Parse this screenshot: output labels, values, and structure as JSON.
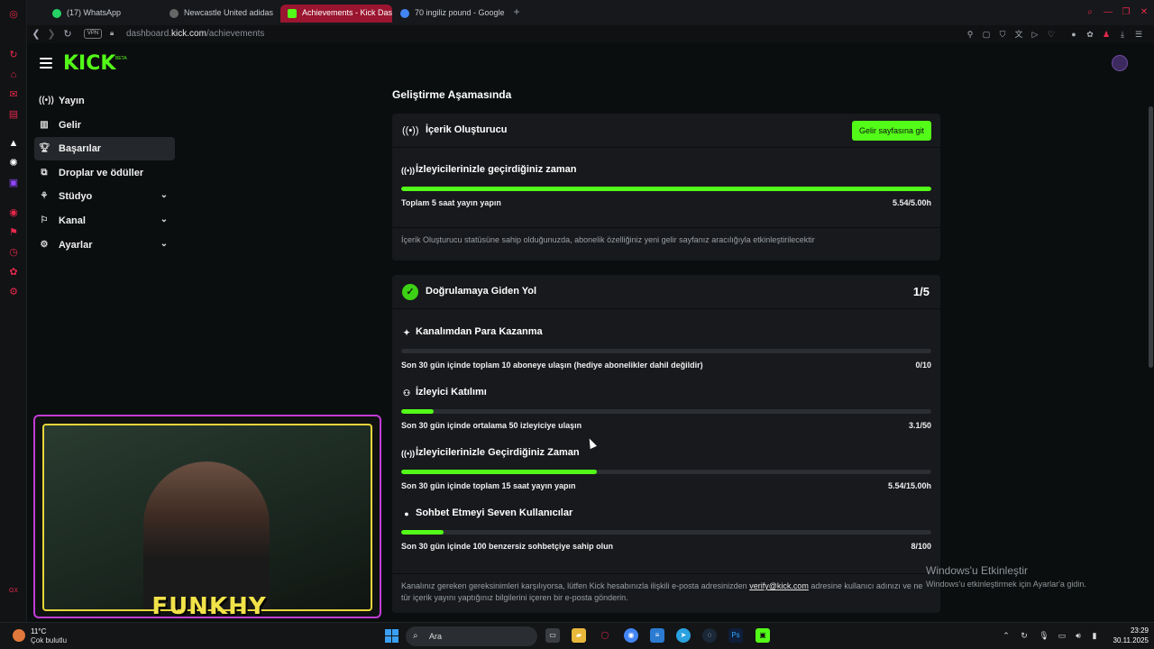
{
  "browser": {
    "tabs": [
      {
        "label": "(17) WhatsApp",
        "icon": "whatsapp-icon",
        "color": "#25d366"
      },
      {
        "label": "Newcastle United adidas",
        "icon": "shop-icon",
        "color": "#888888"
      },
      {
        "label": "Achievements - Kick Das",
        "icon": "kick-icon",
        "color": "#53fc18"
      },
      {
        "label": "70 ingiliz pound - Google",
        "icon": "google-icon",
        "color": "#4285f4"
      }
    ],
    "new_tab": "+",
    "vpn": "VPN",
    "url_prefix": "dashboard.",
    "url_domain": "kick.com",
    "url_path": "/achievements"
  },
  "app": {
    "logo": "KICK",
    "logo_badge": "BETA",
    "accent": "#53fc18"
  },
  "sidebar": {
    "items": [
      {
        "label": "Yayın",
        "icon": "broadcast-icon"
      },
      {
        "label": "Gelir",
        "icon": "income-icon"
      },
      {
        "label": "Başarılar",
        "icon": "trophy-icon",
        "active": true
      },
      {
        "label": "Droplar ve ödüller",
        "icon": "drops-icon"
      },
      {
        "label": "Stüdyo",
        "icon": "studio-icon",
        "expandable": true
      },
      {
        "label": "Kanal",
        "icon": "channel-icon",
        "expandable": true
      },
      {
        "label": "Ayarlar",
        "icon": "gear-icon",
        "expandable": true
      }
    ]
  },
  "main": {
    "section_title": "Geliştirme Aşamasında",
    "creator_card": {
      "title": "İçerik Oluşturucu",
      "button": "Gelir sayfasına git",
      "metric": {
        "title": "İzleyicilerinizle geçirdiğiniz zaman",
        "label": "Toplam 5 saat yayın yapın",
        "value": "5.54/5.00h",
        "progress": 1.0
      },
      "note": "İçerik Oluşturucu statüsüne sahip olduğunuzda, abonelik özelliğiniz yeni gelir sayfanız aracılığıyla etkinleştirilecektir"
    },
    "verify_card": {
      "title": "Doğrulamaya Giden Yol",
      "count": "1/5",
      "metrics": [
        {
          "title": "Kanalımdan Para Kazanma",
          "icon": "sparkle-icon",
          "label": "Son 30 gün içinde toplam 10 aboneye ulaşın (hediye abonelikler dahil değildir)",
          "value": "0/10",
          "progress": 0.0
        },
        {
          "title": "İzleyici Katılımı",
          "icon": "viewers-icon",
          "label": "Son 30 gün içinde ortalama 50 izleyiciye ulaşın",
          "value": "3.1/50",
          "progress": 0.062
        },
        {
          "title": "İzleyicilerinizle Geçirdiğiniz Zaman",
          "icon": "broadcast-icon",
          "label": "Son 30 gün içinde toplam 15 saat yayın yapın",
          "value": "5.54/15.00h",
          "progress": 0.369
        },
        {
          "title": "Sohbet Etmeyi Seven Kullanıcılar",
          "icon": "chat-icon",
          "label": "Son 30 gün içinde 100 benzersiz sohbetçiye sahip olun",
          "value": "8/100",
          "progress": 0.08
        }
      ],
      "notice_pre": "Kanalınız gereken gereksinimleri karşılıyorsa, lütfen Kick hesabınızla ilişkili e-posta adresinizden ",
      "notice_link": "verify@kick.com",
      "notice_post": " adresine kullanıcı adınızı ve ne tür içerik yayını yaptığınız bilgilerini içeren bir e-posta gönderin."
    }
  },
  "windows_activation": {
    "title": "Windows'u Etkinleştir",
    "subtitle": "Windows'u etkinleştirmek için Ayarlar'a gidin."
  },
  "webcam": {
    "name": "FUNKHY",
    "frame_color": "#c23cd6",
    "inner_color": "#e7d63a"
  },
  "taskbar": {
    "temp": "11°C",
    "weather": "Çok bulutlu",
    "search": "Ara",
    "time": "23:29",
    "date": "30.11.2025",
    "apps": [
      "file-explorer",
      "taskview",
      "folder",
      "opera",
      "chrome",
      "notepad",
      "telegram",
      "steam",
      "photoshop",
      "obs"
    ]
  }
}
